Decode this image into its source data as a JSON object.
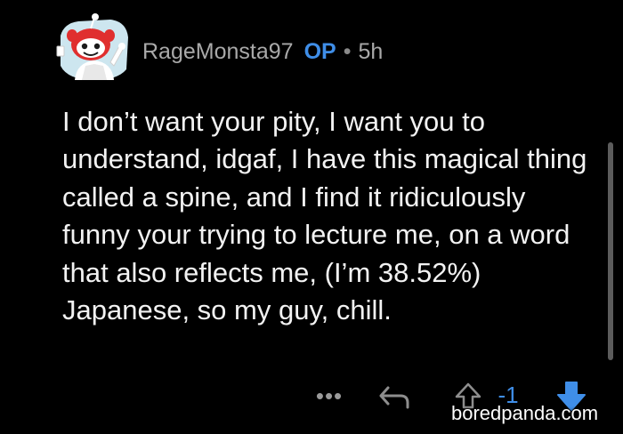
{
  "comment": {
    "author": "RageMonsta97",
    "op_badge": "OP",
    "separator": "•",
    "age": "5h",
    "body": "I don’t want your pity, I want you to understand, idgaf, I have this magical thing called a spine, and I find it ridiculously funny your trying to lecture me, on a word that also reflects me, (I’m 38.52%) Japanese, so my guy, chill."
  },
  "actions": {
    "more_label": "•••",
    "vote_count": "-1",
    "vote_state": "downvoted"
  },
  "watermark": "boredpanda.com",
  "colors": {
    "background": "#000000",
    "op_blue": "#3f8ee8",
    "muted_text": "#a9a9a9",
    "body_text": "#f2f2f2"
  },
  "icons": {
    "avatar": "snoo-avatar-icon",
    "reply": "reply-arrow-icon",
    "upvote": "upvote-arrow-icon",
    "downvote": "downvote-arrow-icon"
  }
}
